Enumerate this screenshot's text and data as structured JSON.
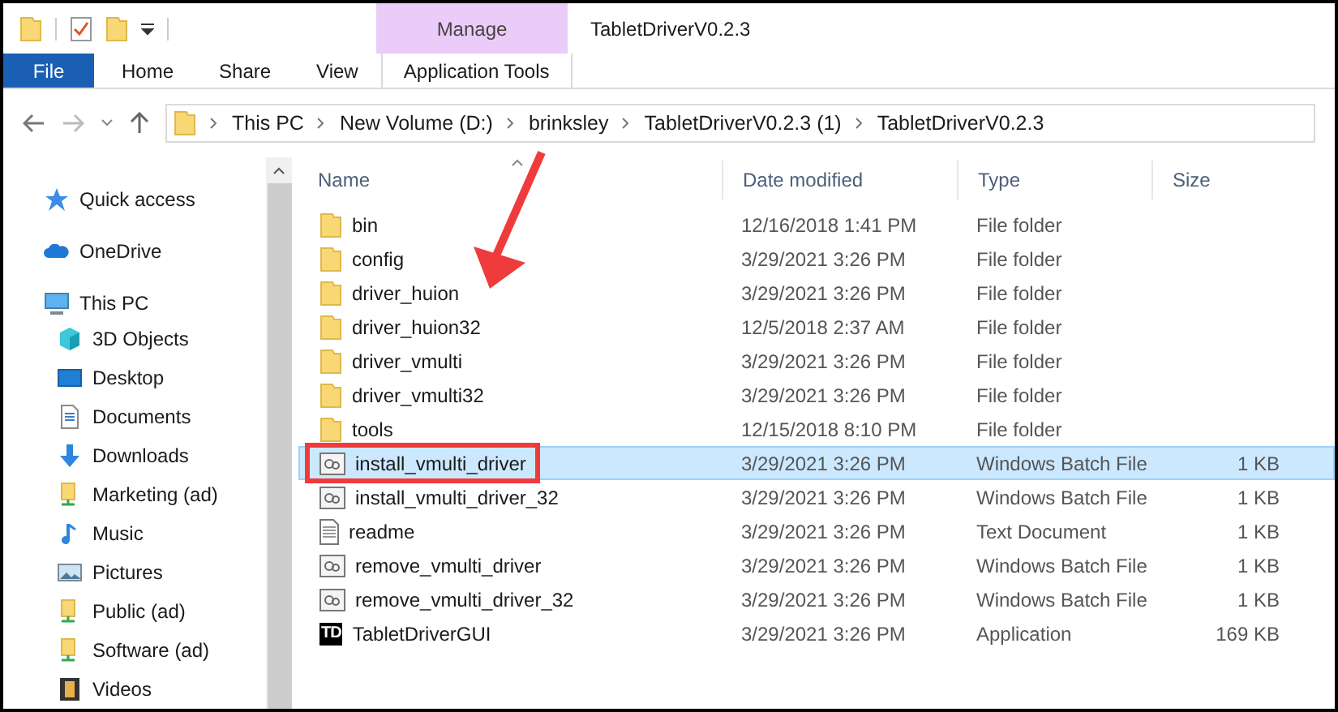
{
  "window": {
    "title": "TabletDriverV0.2.3"
  },
  "context_tab": {
    "label": "Manage"
  },
  "ribbon_tabs": [
    {
      "label": "File",
      "kind": "file",
      "selected": false
    },
    {
      "label": "Home",
      "kind": "tab",
      "selected": false
    },
    {
      "label": "Share",
      "kind": "tab",
      "selected": false
    },
    {
      "label": "View",
      "kind": "tab",
      "selected": false
    },
    {
      "label": "Application Tools",
      "kind": "context",
      "selected": false
    }
  ],
  "breadcrumb": [
    "This PC",
    "New Volume (D:)",
    "brinksley",
    "TabletDriverV0.2.3 (1)",
    "TabletDriverV0.2.3"
  ],
  "sidebar": {
    "items": [
      {
        "label": "Quick access",
        "kind": "star"
      },
      {
        "label": "OneDrive",
        "kind": "cloud"
      },
      {
        "label": "This PC",
        "kind": "pc",
        "children": [
          {
            "label": "3D Objects",
            "kind": "cube"
          },
          {
            "label": "Desktop",
            "kind": "desktop"
          },
          {
            "label": "Documents",
            "kind": "doc"
          },
          {
            "label": "Downloads",
            "kind": "download"
          },
          {
            "label": "Marketing (ad)",
            "kind": "share"
          },
          {
            "label": "Music",
            "kind": "music"
          },
          {
            "label": "Pictures",
            "kind": "pictures"
          },
          {
            "label": "Public (ad)",
            "kind": "share"
          },
          {
            "label": "Software (ad)",
            "kind": "share"
          },
          {
            "label": "Videos",
            "kind": "video"
          }
        ]
      }
    ]
  },
  "table": {
    "columns": [
      "Name",
      "Date modified",
      "Type",
      "Size"
    ],
    "rows": [
      {
        "name": "bin",
        "date": "12/16/2018 1:41 PM",
        "type": "File folder",
        "kind": "folder",
        "selected": false,
        "annotated": false
      },
      {
        "name": "config",
        "date": "3/29/2021 3:26 PM",
        "type": "File folder",
        "kind": "folder",
        "selected": false,
        "annotated": false
      },
      {
        "name": "driver_huion",
        "date": "3/29/2021 3:26 PM",
        "type": "File folder",
        "kind": "folder",
        "selected": false,
        "annotated": false
      },
      {
        "name": "driver_huion32",
        "date": "12/5/2018 2:37 AM",
        "type": "File folder",
        "kind": "folder",
        "selected": false,
        "annotated": false
      },
      {
        "name": "driver_vmulti",
        "date": "3/29/2021 3:26 PM",
        "type": "File folder",
        "kind": "folder",
        "selected": false,
        "annotated": false
      },
      {
        "name": "driver_vmulti32",
        "date": "3/29/2021 3:26 PM",
        "type": "File folder",
        "kind": "folder",
        "selected": false,
        "annotated": false
      },
      {
        "name": "tools",
        "date": "12/15/2018 8:10 PM",
        "type": "File folder",
        "kind": "folder",
        "selected": false,
        "annotated": false
      },
      {
        "name": "install_vmulti_driver",
        "date": "3/29/2021 3:26 PM",
        "type": "Windows Batch File",
        "size": "1 KB",
        "kind": "batch",
        "selected": true,
        "annotated": true
      },
      {
        "name": "install_vmulti_driver_32",
        "date": "3/29/2021 3:26 PM",
        "type": "Windows Batch File",
        "size": "1 KB",
        "kind": "batch",
        "selected": false,
        "annotated": false
      },
      {
        "name": "readme",
        "date": "3/29/2021 3:26 PM",
        "type": "Text Document",
        "size": "1 KB",
        "kind": "text",
        "selected": false,
        "annotated": false
      },
      {
        "name": "remove_vmulti_driver",
        "date": "3/29/2021 3:26 PM",
        "type": "Windows Batch File",
        "size": "1 KB",
        "kind": "batch",
        "selected": false,
        "annotated": false
      },
      {
        "name": "remove_vmulti_driver_32",
        "date": "3/29/2021 3:26 PM",
        "type": "Windows Batch File",
        "size": "1 KB",
        "kind": "batch",
        "selected": false,
        "annotated": false
      },
      {
        "name": "TabletDriverGUI",
        "date": "3/29/2021 3:26 PM",
        "type": "Application",
        "size": "169 KB",
        "kind": "app",
        "icon_text": "TD",
        "selected": false,
        "annotated": false
      }
    ]
  }
}
